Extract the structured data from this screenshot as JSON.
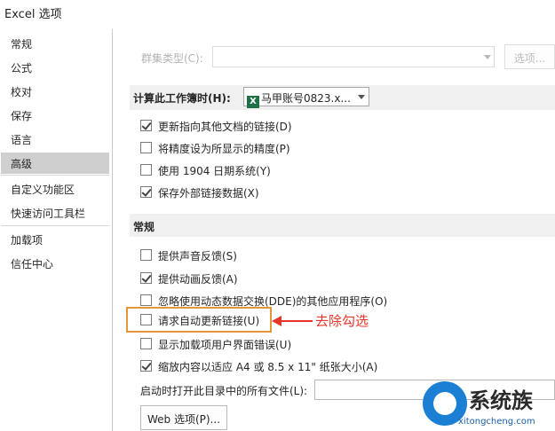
{
  "window": {
    "title": "Excel 选项"
  },
  "sidebar": {
    "items": [
      {
        "label": "常规"
      },
      {
        "label": "公式"
      },
      {
        "label": "校对"
      },
      {
        "label": "保存"
      },
      {
        "label": "语言"
      },
      {
        "label": "高级",
        "selected": true
      },
      {
        "label": "自定义功能区"
      },
      {
        "label": "快速访问工具栏"
      },
      {
        "label": "加载项"
      },
      {
        "label": "信任中心"
      }
    ]
  },
  "top": {
    "cluster_type_label": "群集类型(C):",
    "options_button": "选项..."
  },
  "calc_section": {
    "header": "计算此工作簿时(H):",
    "workbook_value": "马甲账号0823.x...",
    "options": [
      {
        "label": "更新指向其他文档的链接(D)",
        "checked": true
      },
      {
        "label": "将精度设为所显示的精度(P)",
        "checked": false
      },
      {
        "label": "使用 1904 日期系统(Y)",
        "checked": false
      },
      {
        "label": "保存外部链接数据(X)",
        "checked": true
      }
    ]
  },
  "general_section": {
    "header": "常规",
    "options": [
      {
        "label": "提供声音反馈(S)",
        "checked": false
      },
      {
        "label": "提供动画反馈(A)",
        "checked": true
      },
      {
        "label": "忽略使用动态数据交换(DDE)的其他应用程序(O)",
        "checked": false
      },
      {
        "label": "请求自动更新链接(U)",
        "checked": false
      },
      {
        "label": "显示加载项用户界面错误(U)",
        "checked": false
      },
      {
        "label": "缩放内容以适应 A4 或 8.5 x 11\" 纸张大小(A)",
        "checked": true
      }
    ],
    "startup_files_label": "启动时打开此目录中的所有文件(L):",
    "startup_files_value": "",
    "web_options_button": "Web 选项(P)..."
  },
  "annotation": {
    "text": "去除勾选",
    "color": "#e8352a"
  },
  "watermark": {
    "brand": "系统族",
    "url": "xitongcheng.com"
  },
  "colors": {
    "selected_nav": "#cfcfcf",
    "section_bg": "#f0f0f0",
    "excel_green": "#1e7145",
    "highlight_border": "#e4973a"
  }
}
